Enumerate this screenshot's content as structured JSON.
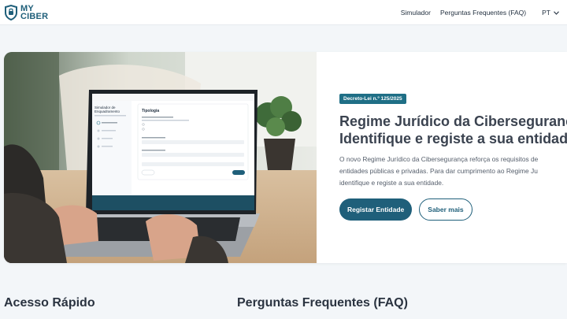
{
  "header": {
    "logo": {
      "line1": "MY",
      "line2": "CIBER"
    },
    "nav": {
      "simulador": "Simulador",
      "faq": "Perguntas Frequentes (FAQ)",
      "language": "PT"
    }
  },
  "hero": {
    "badge": "Decreto-Lei n.º 125/2025",
    "title_line1": "Regime Jurídico da Cibersegurança",
    "title_line2": "Identifique e registe a sua entidade",
    "desc_line1": "O novo Regime Jurídico da Cibersegurança reforça os requisitos de",
    "desc_line2": "entidades públicas e privadas. Para dar cumprimento ao Regime Ju",
    "desc_line3": "identifique e registe a sua entidade.",
    "btn_primary": "Registar Entidade",
    "btn_secondary": "Saber mais",
    "screen": {
      "sidebar_title_1": "Simulador de",
      "sidebar_title_2": "Enquadramento",
      "panel_title": "Tipologia"
    }
  },
  "sections": {
    "quick_access": "Acesso Rápido",
    "faq": "Perguntas Frequentes (FAQ)"
  },
  "colors": {
    "brand": "#1f5f7a",
    "badge": "#1f6f86",
    "background": "#f3f6f9"
  },
  "icons": {
    "logo": "shield-icon",
    "language_caret": "chevron-down-icon"
  }
}
